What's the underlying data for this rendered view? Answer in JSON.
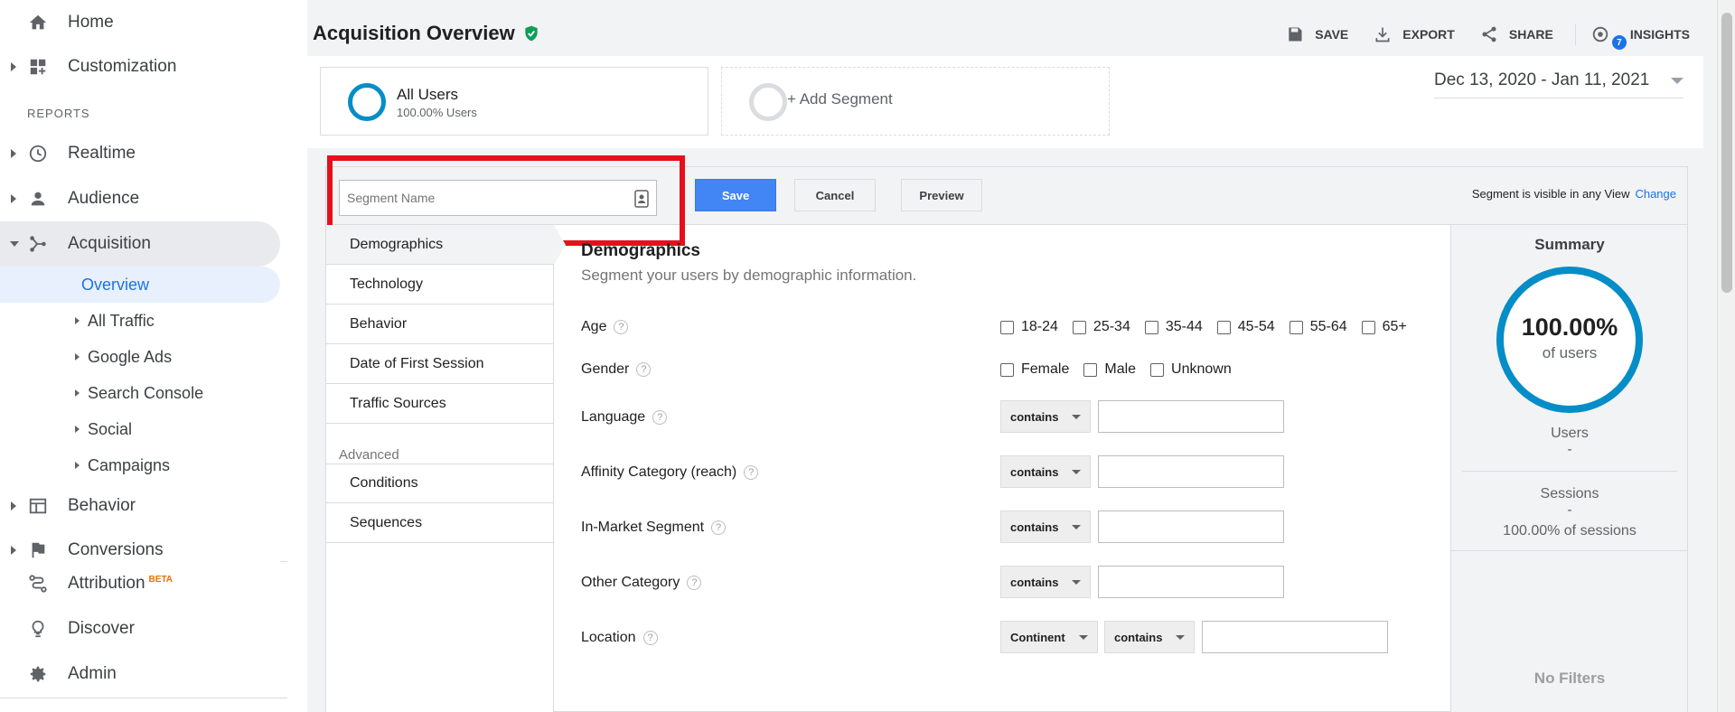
{
  "sidebar": {
    "top_items": [
      {
        "label": "Home",
        "icon": "home-icon"
      },
      {
        "label": "Customization",
        "icon": "dashboard-icon"
      }
    ],
    "reports_header": "REPORTS",
    "report_items": [
      {
        "label": "Realtime",
        "icon": "clock-icon"
      },
      {
        "label": "Audience",
        "icon": "person-icon"
      },
      {
        "label": "Acquisition",
        "icon": "acquisition-icon"
      }
    ],
    "acquisition_sub": [
      {
        "label": "Overview"
      },
      {
        "label": "All Traffic"
      },
      {
        "label": "Google Ads"
      },
      {
        "label": "Search Console"
      },
      {
        "label": "Social"
      },
      {
        "label": "Campaigns"
      }
    ],
    "more_items": [
      {
        "label": "Behavior",
        "icon": "behavior-icon"
      },
      {
        "label": "Conversions",
        "icon": "flag-icon"
      }
    ],
    "bottom_items": [
      {
        "label": "Attribution",
        "icon": "attribution-icon",
        "badge": "BETA"
      },
      {
        "label": "Discover",
        "icon": "lightbulb-icon"
      },
      {
        "label": "Admin",
        "icon": "gear-icon"
      }
    ]
  },
  "header": {
    "title": "Acquisition Overview",
    "actions": {
      "save": "SAVE",
      "export": "EXPORT",
      "share": "SHARE",
      "insights": "INSIGHTS"
    },
    "insights_badge": "7"
  },
  "segments": {
    "active": {
      "name": "All Users",
      "sub": "100.00% Users"
    },
    "add_label": "+ Add Segment"
  },
  "date_range": "Dec 13, 2020 - Jan 11, 2021",
  "editor": {
    "segment_name_placeholder": "Segment Name",
    "save_label": "Save",
    "cancel_label": "Cancel",
    "preview_label": "Preview",
    "visibility_text": "Segment is visible in any View",
    "change_label": "Change",
    "categories": [
      "Demographics",
      "Technology",
      "Behavior",
      "Date of First Session",
      "Traffic Sources"
    ],
    "advanced_label": "Advanced",
    "advanced_items": [
      "Conditions",
      "Sequences"
    ]
  },
  "demographics": {
    "title": "Demographics",
    "subtitle": "Segment your users by demographic information.",
    "age_label": "Age",
    "age_options": [
      "18-24",
      "25-34",
      "35-44",
      "45-54",
      "55-64",
      "65+"
    ],
    "gender_label": "Gender",
    "gender_options": [
      "Female",
      "Male",
      "Unknown"
    ],
    "language_label": "Language",
    "affinity_label": "Affinity Category (reach)",
    "in_market_label": "In-Market Segment",
    "other_label": "Other Category",
    "location_label": "Location",
    "contains": "contains",
    "continent": "Continent",
    "help": "?"
  },
  "summary": {
    "title": "Summary",
    "percent": "100.00%",
    "of_users": "of users",
    "users_label": "Users",
    "users_value": "-",
    "sessions_label": "Sessions",
    "sessions_value": "-",
    "sessions_pct": "100.00% of sessions",
    "no_filters": "No Filters"
  },
  "colors": {
    "accent": "#058dc7",
    "primary_button": "#4285f4",
    "highlight": "#e5101c",
    "link": "#1a73e8"
  }
}
